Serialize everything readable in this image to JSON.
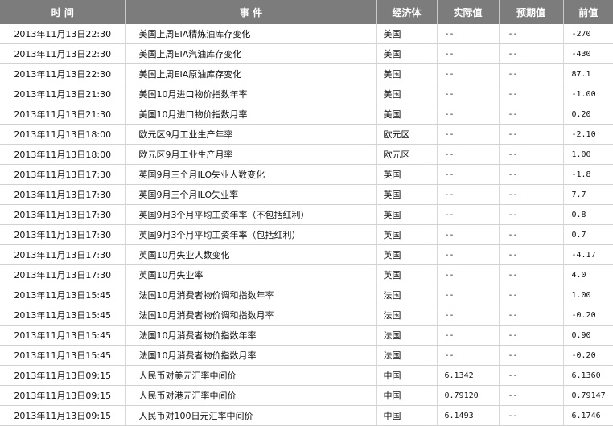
{
  "header": {
    "time": "时 间",
    "event": "事 件",
    "economy": "经济体",
    "actual": "实际值",
    "expected": "预期值",
    "previous": "前值"
  },
  "rows": [
    {
      "time": "2013年11月13日22:30",
      "event": "美国上周EIA精炼油库存变化",
      "economy": "美国",
      "actual": "--",
      "expected": "--",
      "previous": "-270"
    },
    {
      "time": "2013年11月13日22:30",
      "event": "美国上周EIA汽油库存变化",
      "economy": "美国",
      "actual": "--",
      "expected": "--",
      "previous": "-430"
    },
    {
      "time": "2013年11月13日22:30",
      "event": "美国上周EIA原油库存变化",
      "economy": "美国",
      "actual": "--",
      "expected": "--",
      "previous": "87.1"
    },
    {
      "time": "2013年11月13日21:30",
      "event": "美国10月进口物价指数年率",
      "economy": "美国",
      "actual": "--",
      "expected": "--",
      "previous": "-1.00"
    },
    {
      "time": "2013年11月13日21:30",
      "event": "美国10月进口物价指数月率",
      "economy": "美国",
      "actual": "--",
      "expected": "--",
      "previous": "0.20"
    },
    {
      "time": "2013年11月13日18:00",
      "event": "欧元区9月工业生产年率",
      "economy": "欧元区",
      "actual": "--",
      "expected": "--",
      "previous": "-2.10"
    },
    {
      "time": "2013年11月13日18:00",
      "event": "欧元区9月工业生产月率",
      "economy": "欧元区",
      "actual": "--",
      "expected": "--",
      "previous": "1.00"
    },
    {
      "time": "2013年11月13日17:30",
      "event": "英国9月三个月ILO失业人数变化",
      "economy": "英国",
      "actual": "--",
      "expected": "--",
      "previous": "-1.8"
    },
    {
      "time": "2013年11月13日17:30",
      "event": "英国9月三个月ILO失业率",
      "economy": "英国",
      "actual": "--",
      "expected": "--",
      "previous": "7.7"
    },
    {
      "time": "2013年11月13日17:30",
      "event": "英国9月3个月平均工资年率（不包括红利）",
      "economy": "英国",
      "actual": "--",
      "expected": "--",
      "previous": "0.8"
    },
    {
      "time": "2013年11月13日17:30",
      "event": "英国9月3个月平均工资年率（包括红利）",
      "economy": "英国",
      "actual": "--",
      "expected": "--",
      "previous": "0.7"
    },
    {
      "time": "2013年11月13日17:30",
      "event": "英国10月失业人数变化",
      "economy": "英国",
      "actual": "--",
      "expected": "--",
      "previous": "-4.17"
    },
    {
      "time": "2013年11月13日17:30",
      "event": "英国10月失业率",
      "economy": "英国",
      "actual": "--",
      "expected": "--",
      "previous": "4.0"
    },
    {
      "time": "2013年11月13日15:45",
      "event": "法国10月消费者物价调和指数年率",
      "economy": "法国",
      "actual": "--",
      "expected": "--",
      "previous": "1.00"
    },
    {
      "time": "2013年11月13日15:45",
      "event": "法国10月消费者物价调和指数月率",
      "economy": "法国",
      "actual": "--",
      "expected": "--",
      "previous": "-0.20"
    },
    {
      "time": "2013年11月13日15:45",
      "event": "法国10月消费者物价指数年率",
      "economy": "法国",
      "actual": "--",
      "expected": "--",
      "previous": "0.90"
    },
    {
      "time": "2013年11月13日15:45",
      "event": "法国10月消费者物价指数月率",
      "economy": "法国",
      "actual": "--",
      "expected": "--",
      "previous": "-0.20"
    },
    {
      "time": "2013年11月13日09:15",
      "event": "人民币对美元汇率中间价",
      "economy": "中国",
      "actual": "6.1342",
      "expected": "--",
      "previous": "6.1360"
    },
    {
      "time": "2013年11月13日09:15",
      "event": "人民币对港元汇率中间价",
      "economy": "中国",
      "actual": "0.79120",
      "expected": "--",
      "previous": "0.79147"
    },
    {
      "time": "2013年11月13日09:15",
      "event": "人民币对100日元汇率中间价",
      "economy": "中国",
      "actual": "6.1493",
      "expected": "--",
      "previous": "6.1746"
    }
  ]
}
